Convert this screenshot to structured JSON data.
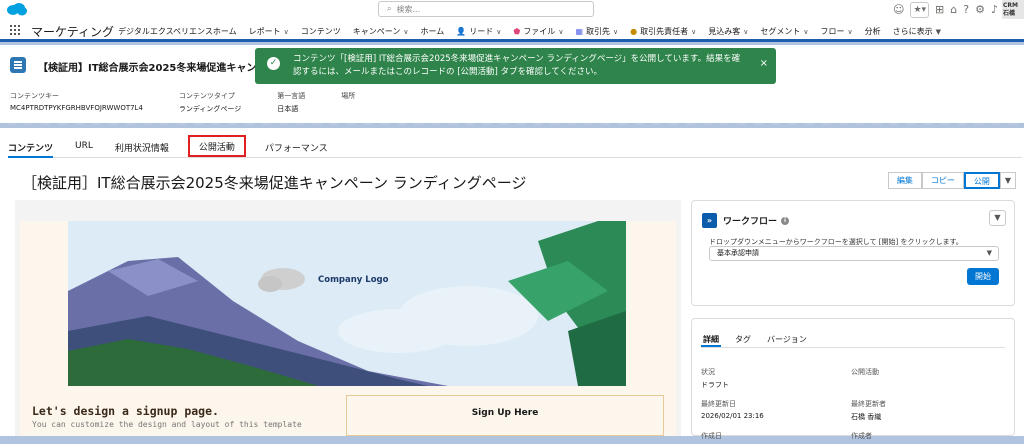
{
  "search": {
    "placeholder": "検索..."
  },
  "user": {
    "avatar_text": "CRM\n石橋"
  },
  "app": {
    "name": "マーケティング"
  },
  "nav": {
    "items": [
      {
        "label": "デジタルエクスペリエンスホーム",
        "chev": ""
      },
      {
        "label": "レポート",
        "chev": "∨"
      },
      {
        "label": "コンテンツ",
        "chev": ""
      },
      {
        "label": "キャンペーン",
        "chev": "∨"
      },
      {
        "label": "ホーム",
        "chev": ""
      },
      {
        "label": "リード",
        "chev": "∨"
      },
      {
        "label": "ファイル",
        "chev": "∨"
      },
      {
        "label": "取引先",
        "chev": "∨"
      },
      {
        "label": "取引先責任者",
        "chev": "∨"
      },
      {
        "label": "見込み客",
        "chev": "∨"
      },
      {
        "label": "セグメント",
        "chev": "∨"
      },
      {
        "label": "フロー",
        "chev": "∨"
      },
      {
        "label": "分析",
        "chev": ""
      },
      {
        "label": "さらに表示",
        "chev": "▼"
      }
    ]
  },
  "header": {
    "title": "【検証用】IT総合展示会2025冬来場促進キャンペー",
    "fields": [
      {
        "label": "コンテンツキー",
        "value": "MC4PTRDTPYKFGRHBVFOJRWWOT7L4"
      },
      {
        "label": "コンテンツタイプ",
        "value": "ランディングページ"
      },
      {
        "label": "第一言語",
        "value": "日本語"
      },
      {
        "label": "場所",
        "value": ""
      }
    ]
  },
  "toast": {
    "line1": "コンテンツ「[検証用] IT総合展示会2025冬来場促進キャンペーン ランディングページ」を公開しています。結果を確",
    "line2": "認するには、メールまたはこのレコードの [公開活動] タブを確認してください。",
    "close": "×"
  },
  "tabs": [
    {
      "label": "コンテンツ"
    },
    {
      "label": "URL"
    },
    {
      "label": "利用状況情報"
    },
    {
      "label": "公開活動"
    },
    {
      "label": "パフォーマンス"
    }
  ],
  "page": {
    "title": "［検証用］IT総合展示会2025冬来場促進キャンペーン ランディングページ"
  },
  "actions": {
    "edit": "編集",
    "copy": "コピー",
    "publish": "公開",
    "more": "▼"
  },
  "preview": {
    "company_logo": "Company Logo",
    "headline": "Let's design a signup page.",
    "subtext": "You can customize the design and layout of this template",
    "signup_title": "Sign Up Here"
  },
  "workflow": {
    "title": "ワークフロー",
    "hint": "ドロップダウンメニューからワークフローを選択して [開始] をクリックします。",
    "selected": "基本承認申請",
    "start": "開始"
  },
  "details": {
    "tabs": [
      {
        "label": "詳細"
      },
      {
        "label": "タグ"
      },
      {
        "label": "バージョン"
      }
    ],
    "fields": [
      {
        "label": "状況",
        "value": "ドラフト"
      },
      {
        "label": "公開活動",
        "value": ""
      },
      {
        "label": "最終更新日",
        "value": "2026/02/01 23:16"
      },
      {
        "label": "最終更新者",
        "value": "石橋 香織"
      },
      {
        "label": "作成日",
        "value": ""
      },
      {
        "label": "作成者",
        "value": ""
      }
    ]
  },
  "colors": {
    "brand": "#0176d3",
    "toast": "#2e844a",
    "highlight": "#e02020"
  }
}
